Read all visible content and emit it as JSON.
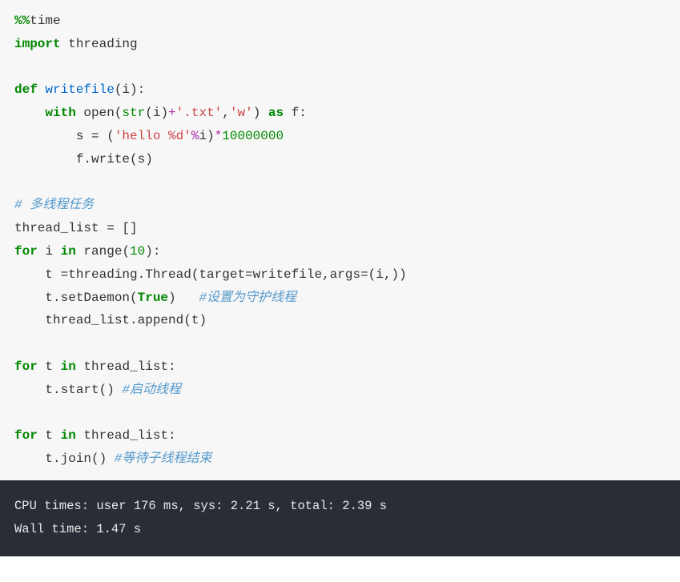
{
  "code": {
    "l1_magic": "%%",
    "l1_time": "time",
    "l2_import": "import",
    "l2_mod": " threading",
    "l4_def": "def",
    "l4_fname": " writefile",
    "l4_paren": "(i):",
    "l5_with": "with",
    "l5_open": " open(",
    "l5_str": "str",
    "l5_iplus": "(i)",
    "l5_plus": "+",
    "l5_txt": "'.txt'",
    "l5_comma": ",",
    "l5_w": "'w'",
    "l5_close": ") ",
    "l5_as": "as",
    "l5_f": " f:",
    "l6_s": "        s = (",
    "l6_hello": "'hello %d'",
    "l6_pct": "%",
    "l6_i": "i)",
    "l6_mul": "*",
    "l6_num": "10000000",
    "l7_write": "        f.write(s)",
    "l9_comment": "# 多线程任务",
    "l10_thread": "thread_list = []",
    "l11_for": "for",
    "l11_i": " i ",
    "l11_in": "in",
    "l11_range": " range(",
    "l11_ten": "10",
    "l11_close": "):",
    "l12_t": "    t =threading.Thread(target=writefile,args=(i,))",
    "l13_setd": "    t.setDaemon(",
    "l13_true": "True",
    "l13_close": ")   ",
    "l13_comment": "#设置为守护线程",
    "l14_append": "    thread_list.append(t)",
    "l16_for": "for",
    "l16_t": " t ",
    "l16_in": "in",
    "l16_tl": " thread_list:",
    "l17_start": "    t.start() ",
    "l17_comment": "#启动线程",
    "l19_for": "for",
    "l19_t": " t ",
    "l19_in": "in",
    "l19_tl": " thread_list:",
    "l20_join": "    t.join() ",
    "l20_comment": "#等待子线程结束"
  },
  "output": {
    "line1": "CPU times: user 176 ms, sys: 2.21 s, total: 2.39 s",
    "line2": "Wall time: 1.47 s"
  }
}
